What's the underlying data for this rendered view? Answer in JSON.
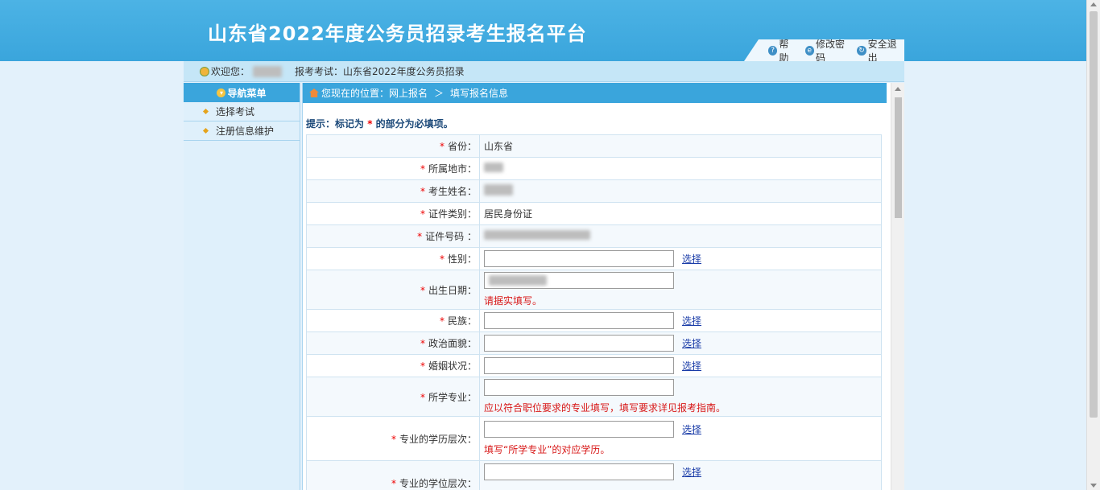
{
  "header": {
    "title": "山东省2022年度公务员招录考生报名平台",
    "links": [
      {
        "icon": "help-icon",
        "glyph": "?",
        "label": "帮 助"
      },
      {
        "icon": "edit-icon",
        "glyph": "e",
        "label": "修改密码"
      },
      {
        "icon": "logout-icon",
        "glyph": "↻",
        "label": "安全退出"
      }
    ]
  },
  "welcome": {
    "greeting": "欢迎您：",
    "exam_label": "报考考试：",
    "exam_name": "山东省2022年度公务员招录"
  },
  "sidebar": {
    "title": "导航菜单",
    "items": [
      {
        "label": "选择考试"
      },
      {
        "label": "注册信息维护"
      }
    ]
  },
  "main": {
    "breadcrumb_prefix": "您现在的位置：",
    "breadcrumb_1": "网上报名",
    "breadcrumb_sep": "＞",
    "breadcrumb_2": "填写报名信息",
    "hint_pre": "提示：标记为",
    "hint_star": "*",
    "hint_post": "的部分为必填项。",
    "pick_label": "选择",
    "rows": [
      {
        "label": "省份：",
        "value": "山东省"
      },
      {
        "label": "所属地市："
      },
      {
        "label": "考生姓名："
      },
      {
        "label": "证件类别：",
        "value": "居民身份证"
      },
      {
        "label": "证件号码 ："
      },
      {
        "label": "性别："
      },
      {
        "label": "出生日期：",
        "note": "请据实填写。"
      },
      {
        "label": "民族："
      },
      {
        "label": "政治面貌："
      },
      {
        "label": "婚姻状况："
      },
      {
        "label": "所学专业：",
        "note": "应以符合职位要求的专业填写，填写要求详见报考指南。"
      },
      {
        "label": "专业的学历层次：",
        "note": "填写“所学专业”的对应学历。"
      },
      {
        "label": "专业的学位层次："
      }
    ]
  },
  "colors": {
    "header_blue": "#3aa5dc",
    "required_red": "#e00000",
    "link_blue": "#1a3ca8"
  }
}
